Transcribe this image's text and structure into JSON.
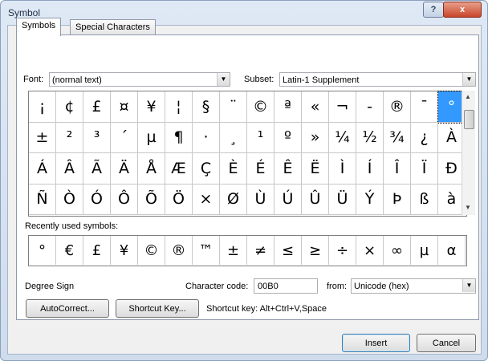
{
  "window": {
    "title": "Symbol"
  },
  "tabs": [
    {
      "label": "Symbols",
      "active": true
    },
    {
      "label": "Special Characters",
      "active": false
    }
  ],
  "font": {
    "label": "Font:",
    "value": "(normal text)"
  },
  "subset": {
    "label": "Subset:",
    "value": "Latin-1 Supplement"
  },
  "symbols": [
    [
      "¡",
      "¢",
      "£",
      "¤",
      "¥",
      "¦",
      "§",
      "¨",
      "©",
      "ª",
      "«",
      "¬",
      "-",
      "®",
      "¯",
      "°"
    ],
    [
      "±",
      "²",
      "³",
      "´",
      "µ",
      "¶",
      "·",
      "¸",
      "¹",
      "º",
      "»",
      "¼",
      "½",
      "¾",
      "¿",
      "À"
    ],
    [
      "Á",
      "Â",
      "Ã",
      "Ä",
      "Å",
      "Æ",
      "Ç",
      "È",
      "É",
      "Ê",
      "Ë",
      "Ì",
      "Í",
      "Î",
      "Ï",
      "Ð"
    ],
    [
      "Ñ",
      "Ò",
      "Ó",
      "Ô",
      "Õ",
      "Ö",
      "×",
      "Ø",
      "Ù",
      "Ú",
      "Û",
      "Ü",
      "Ý",
      "Þ",
      "ß",
      "à"
    ]
  ],
  "selected_symbol": "°",
  "recent": {
    "label": "Recently used symbols:",
    "items": [
      "°",
      "€",
      "£",
      "¥",
      "©",
      "®",
      "™",
      "±",
      "≠",
      "≤",
      "≥",
      "÷",
      "×",
      "∞",
      "µ",
      "α"
    ]
  },
  "char_name": "Degree Sign",
  "char_code": {
    "label": "Character code:",
    "value": "00B0"
  },
  "from": {
    "label": "from:",
    "value": "Unicode (hex)"
  },
  "buttons": {
    "autocorrect": "AutoCorrect...",
    "shortcut_key": "Shortcut Key...",
    "insert": "Insert",
    "cancel": "Cancel"
  },
  "shortcut_text": "Shortcut key: Alt+Ctrl+V,Space",
  "icons": {
    "help": "?",
    "close": "x",
    "dropdown": "▼",
    "scroll_up": "▲",
    "scroll_down": "▼"
  }
}
